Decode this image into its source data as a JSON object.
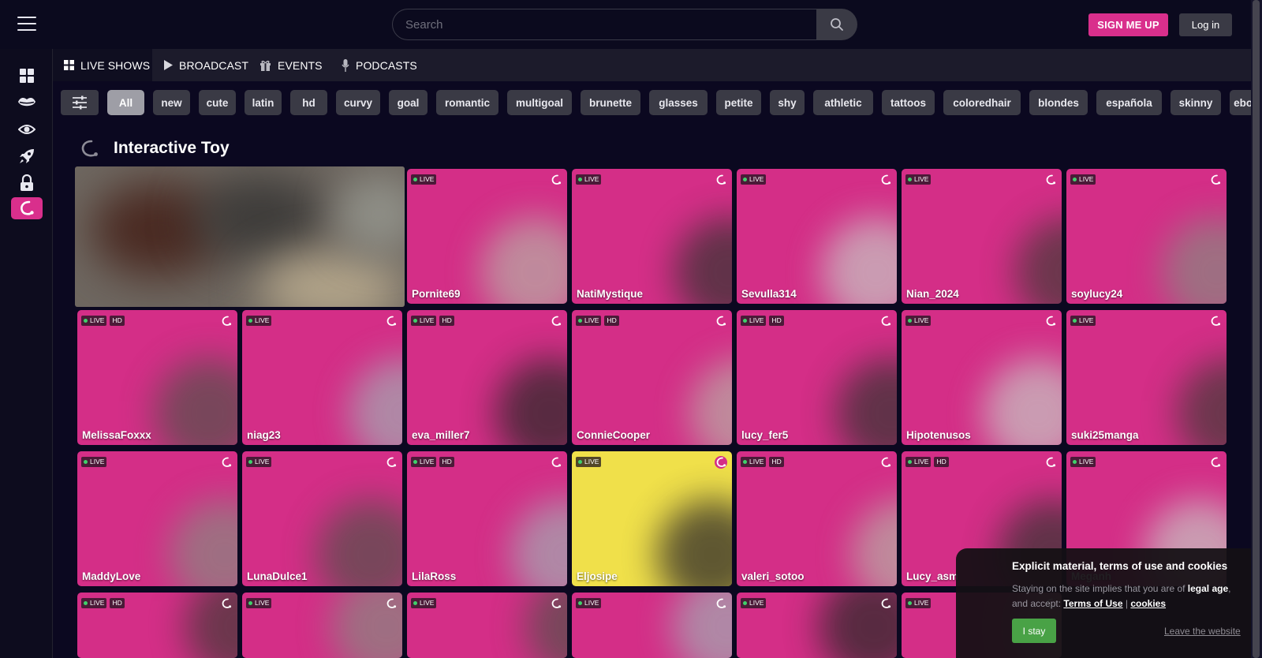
{
  "header": {
    "search_placeholder": "Search",
    "signup_label": "SIGN ME UP",
    "login_label": "Log in"
  },
  "sidebar": {
    "items": [
      {
        "icon": "grid-icon"
      },
      {
        "icon": "lips-icon"
      },
      {
        "icon": "eye-icon"
      },
      {
        "icon": "rocket-icon"
      },
      {
        "icon": "lock-icon"
      },
      {
        "icon": "interactive-toy-icon",
        "active": true
      }
    ]
  },
  "nav": {
    "tabs": [
      {
        "label": "LIVE SHOWS",
        "icon": "grid-icon",
        "active": true
      },
      {
        "label": "BROADCAST",
        "icon": "play-icon"
      },
      {
        "label": "EVENTS",
        "icon": "gift-icon"
      },
      {
        "label": "PODCASTS",
        "icon": "microphone-icon"
      }
    ]
  },
  "tags": [
    "All",
    "new",
    "cute",
    "latin",
    "hd",
    "curvy",
    "goal",
    "romantic",
    "multigoal",
    "brunette",
    "glasses",
    "petite",
    "shy",
    "athletic",
    "tattoos",
    "coloredhair",
    "blondes",
    "española",
    "skinny",
    "ebony"
  ],
  "section": {
    "title": "Interactive Toy"
  },
  "badges": {
    "live": "LIVE",
    "hd": "HD"
  },
  "cards": [
    {
      "name": "Pornite69",
      "hd": false
    },
    {
      "name": "NatiMystique",
      "hd": false
    },
    {
      "name": "Sevulla314",
      "hd": false
    },
    {
      "name": "Nian_2024",
      "hd": false
    },
    {
      "name": "soylucy24",
      "hd": false
    },
    {
      "name": "MelissaFoxxx",
      "hd": true
    },
    {
      "name": "niag23",
      "hd": false
    },
    {
      "name": "eva_miller7",
      "hd": true
    },
    {
      "name": "ConnieCooper",
      "hd": true
    },
    {
      "name": "lucy_fer5",
      "hd": true
    },
    {
      "name": "Hipotenusos",
      "hd": false
    },
    {
      "name": "suki25manga",
      "hd": false
    },
    {
      "name": "MaddyLove",
      "hd": false
    },
    {
      "name": "LunaDulce1",
      "hd": false
    },
    {
      "name": "LilaRoss",
      "hd": true
    },
    {
      "name": "Eljosipe",
      "hd": false,
      "highlight": true
    },
    {
      "name": "valeri_sotoo",
      "hd": true
    },
    {
      "name": "Lucy_asm",
      "hd": true
    },
    {
      "name": "Meganh",
      "hd": false
    },
    {
      "name": "",
      "hd": true
    },
    {
      "name": "",
      "hd": false
    },
    {
      "name": "",
      "hd": false
    },
    {
      "name": "",
      "hd": false
    },
    {
      "name": "",
      "hd": false
    },
    {
      "name": "",
      "hd": false
    }
  ],
  "cookie": {
    "title": "Explicit material, terms of use and cookies",
    "text_before": "Staying on the site implies that you are of ",
    "legal_age": "legal age",
    "text_middle": ", and accept: ",
    "terms_link": "Terms of Use",
    "separator": " | ",
    "cookies_link": "cookies",
    "stay_label": "I stay",
    "leave_label": "Leave the website"
  },
  "colors": {
    "brand_pink": "#d92f8c",
    "stay_green": "#49a246",
    "highlight_yellow": "#f0e04a"
  }
}
